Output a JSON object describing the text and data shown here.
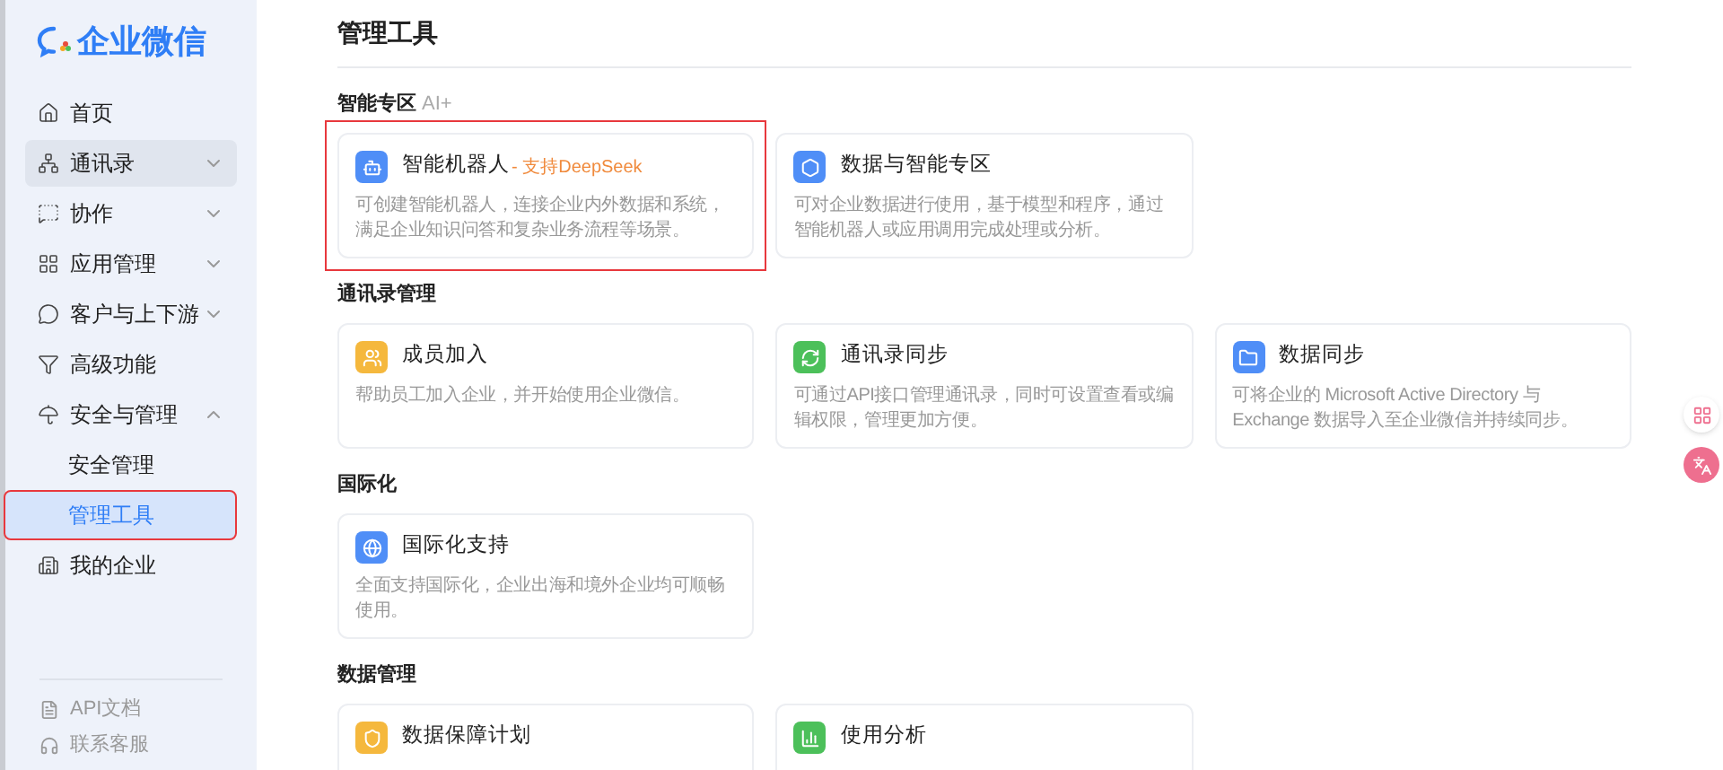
{
  "sidebar": {
    "logo": "企业微信",
    "items": [
      {
        "label": "首页",
        "expandable": false,
        "hovered": false
      },
      {
        "label": "通讯录",
        "expandable": true,
        "expanded": false,
        "hovered": true
      },
      {
        "label": "协作",
        "expandable": true,
        "expanded": false,
        "hovered": false
      },
      {
        "label": "应用管理",
        "expandable": true,
        "expanded": false,
        "hovered": false
      },
      {
        "label": "客户与上下游",
        "expandable": true,
        "expanded": false,
        "hovered": false
      },
      {
        "label": "高级功能",
        "expandable": false,
        "hovered": false
      },
      {
        "label": "安全与管理",
        "expandable": true,
        "expanded": true,
        "hovered": false,
        "children": [
          {
            "label": "安全管理",
            "selected": false,
            "annotated": false
          },
          {
            "label": "管理工具",
            "selected": true,
            "annotated": true
          }
        ]
      },
      {
        "label": "我的企业",
        "expandable": false,
        "hovered": false
      }
    ],
    "footer_links": [
      "API文档",
      "联系客服"
    ]
  },
  "page_title": "管理工具",
  "sections": [
    {
      "title": "智能专区",
      "badge": "AI+",
      "cards": [
        {
          "title": "智能机器人",
          "tag": "- 支持DeepSeek",
          "description": "可创建智能机器人，连接企业内外数据和系统，满足企业知识问答和复杂业务流程等场景。",
          "color": "#4f8ef7",
          "annotated": true
        },
        {
          "title": "数据与智能专区",
          "description": "可对企业数据进行使用，基于模型和程序，通过智能机器人或应用调用完成处理或分析。",
          "color": "#4f8ef7",
          "annotated": false
        }
      ]
    },
    {
      "title": "通讯录管理",
      "cards": [
        {
          "title": "成员加入",
          "description": "帮助员工加入企业，并开始使用企业微信。",
          "color": "#f5b83d",
          "annotated": false
        },
        {
          "title": "通讯录同步",
          "description": "可通过API接口管理通讯录，同时可设置查看或编辑权限，管理更加方便。",
          "color": "#4cc05a",
          "annotated": false
        },
        {
          "title": "数据同步",
          "description": "可将企业的 Microsoft Active Directory 与 Exchange 数据导入至企业微信并持续同步。",
          "color": "#4f8ef7",
          "annotated": false
        }
      ]
    },
    {
      "title": "国际化",
      "cards": [
        {
          "title": "国际化支持",
          "description": "全面支持国际化，企业出海和境外企业均可顺畅使用。",
          "color": "#4f8ef7",
          "annotated": false
        }
      ]
    },
    {
      "title": "数据管理",
      "cards": [
        {
          "title": "数据保障计划",
          "color": "#f5b83d",
          "annotated": false
        },
        {
          "title": "使用分析",
          "color": "#4cc05a",
          "annotated": false
        }
      ]
    }
  ]
}
